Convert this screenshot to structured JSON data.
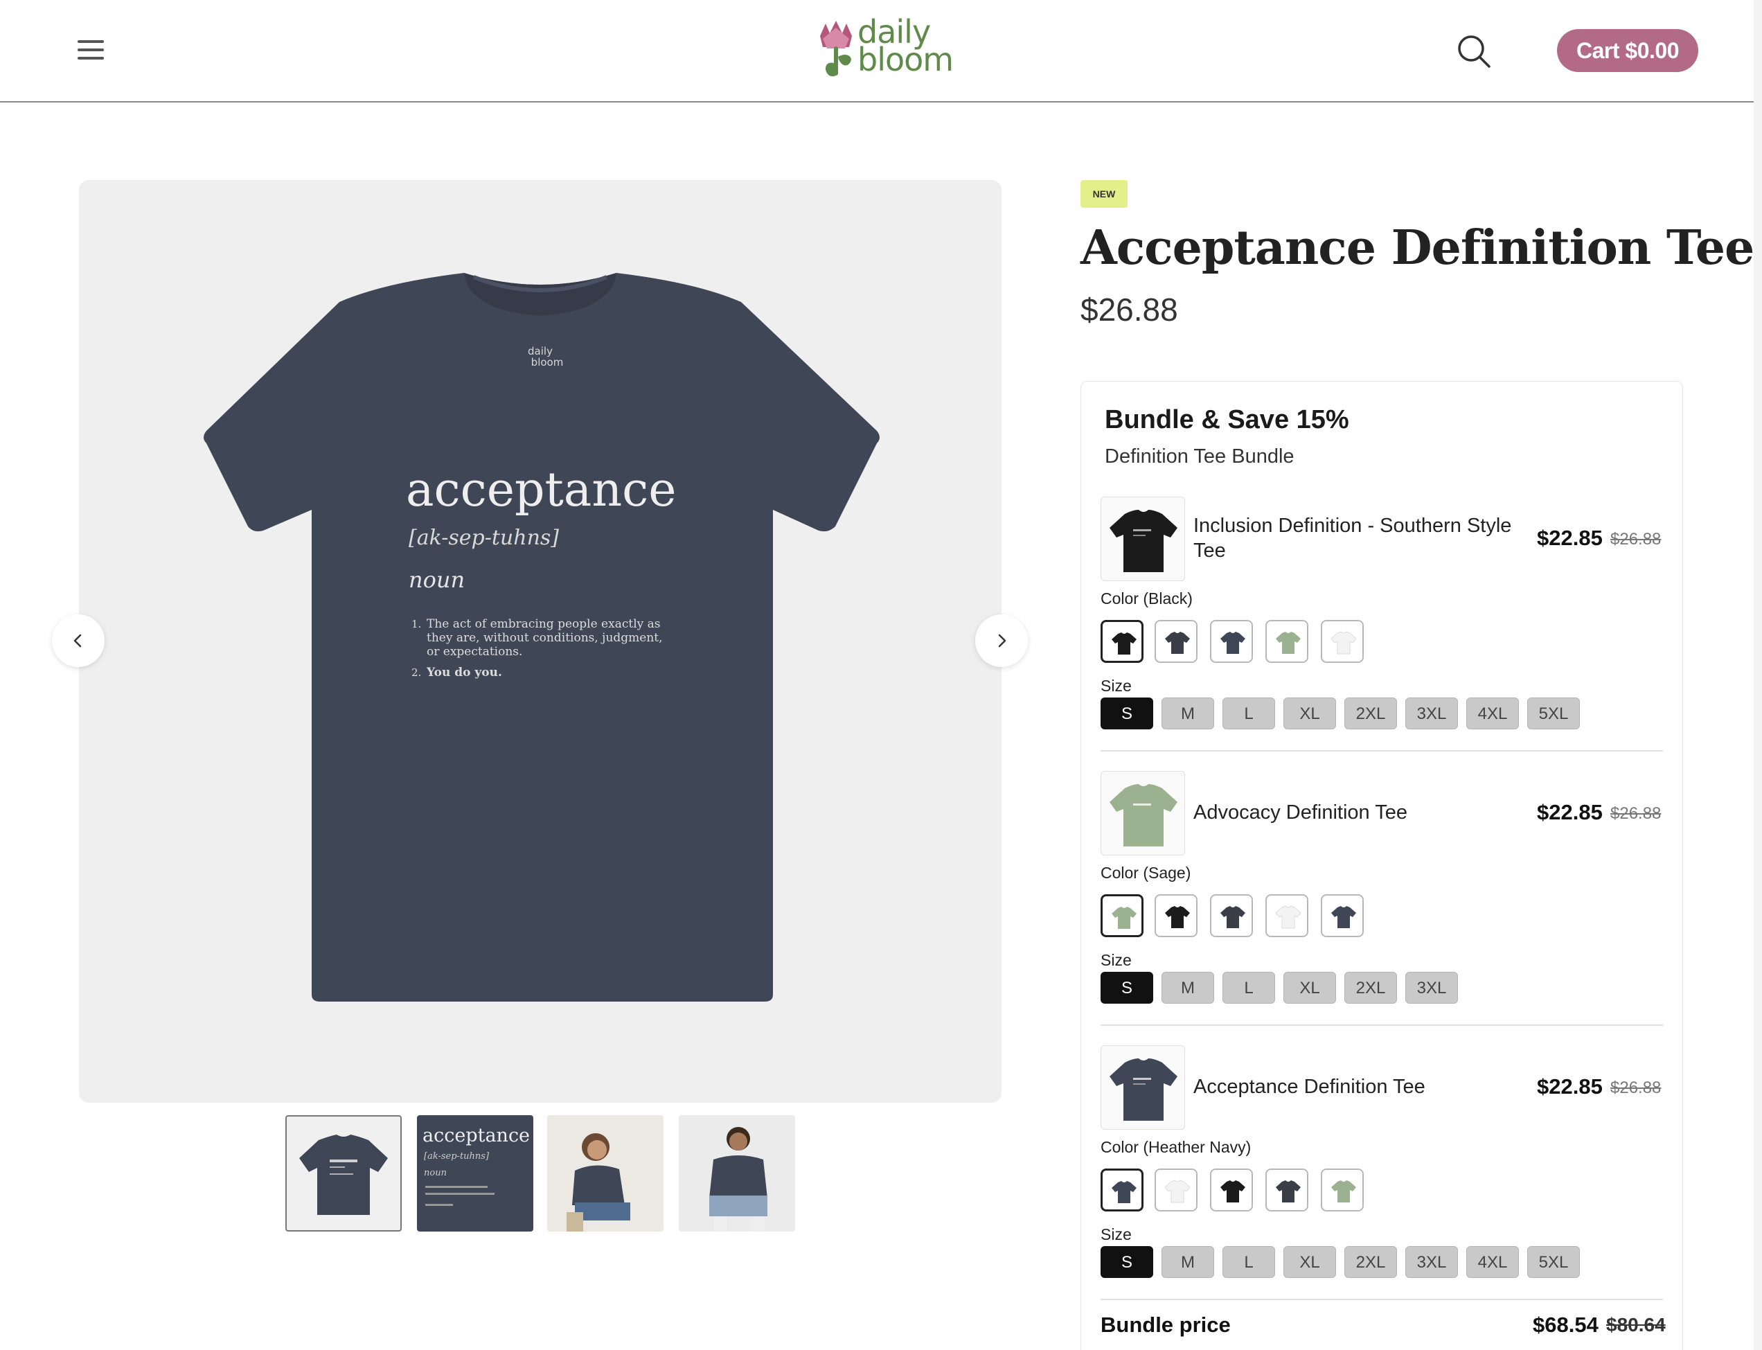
{
  "header": {
    "logo_top": "daily",
    "logo_bottom": "bloom",
    "cart_label": "Cart $0.00",
    "accent_color": "#b36b85"
  },
  "product": {
    "badge": "NEW",
    "title": "Acceptance Definition Tee",
    "price": "$26.88",
    "shirt_color": "#3f4656",
    "print": {
      "word": "acceptance",
      "pronunciation": "[ak-sep-tuhns]",
      "part_of_speech": "noun",
      "def1": "The act of embracing people exactly as",
      "def1b": "they are, without conditions, judgment,",
      "def1c": "or expectations.",
      "def2": "You do you.",
      "n1": "1.",
      "n2": "2."
    },
    "thumb2_word": "acceptance",
    "thumb2_pron": "[ak-sep-tuhns]",
    "thumb2_noun": "noun"
  },
  "bundle": {
    "title": "Bundle & Save 15%",
    "subtitle": "Definition Tee Bundle",
    "items": [
      {
        "name": "Inclusion Definition - Southern Style Tee",
        "price": "$22.85",
        "compare": "$26.88",
        "color_label": "Color (Black)",
        "size_label": "Size",
        "sizes": [
          "S",
          "M",
          "L",
          "XL",
          "2XL",
          "3XL",
          "4XL",
          "5XL"
        ],
        "selected_size": "S"
      },
      {
        "name": "Advocacy Definition Tee",
        "price": "$22.85",
        "compare": "$26.88",
        "color_label": "Color (Sage)",
        "size_label": "Size",
        "sizes": [
          "S",
          "M",
          "L",
          "XL",
          "2XL",
          "3XL"
        ],
        "selected_size": "S"
      },
      {
        "name": "Acceptance Definition Tee",
        "price": "$22.85",
        "compare": "$26.88",
        "color_label": "Color (Heather Navy)",
        "size_label": "Size",
        "sizes": [
          "S",
          "M",
          "L",
          "XL",
          "2XL",
          "3XL",
          "4XL",
          "5XL"
        ],
        "selected_size": "S"
      }
    ],
    "total_label": "Bundle price",
    "total_price": "$68.54",
    "total_compare": "$80.64"
  },
  "colors": {
    "black": "#1b1b1b",
    "charcoal": "#3a3e46",
    "navy": "#3f4656",
    "sage": "#9bb18f",
    "white": "#f3f3f3",
    "badge_new": "#e2f08b"
  }
}
